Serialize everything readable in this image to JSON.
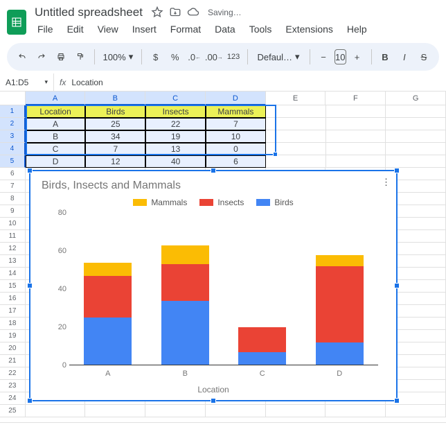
{
  "doc": {
    "title": "Untitled spreadsheet",
    "status": "Saving…"
  },
  "menus": [
    "File",
    "Edit",
    "View",
    "Insert",
    "Format",
    "Data",
    "Tools",
    "Extensions",
    "Help"
  ],
  "toolbar": {
    "zoom": "100%",
    "currency": "$",
    "percent": "%",
    "font": "Defaul…",
    "fontsize": "10",
    "fmt123": "123"
  },
  "namebox": {
    "ref": "A1:D5",
    "formula": "Location"
  },
  "columns": [
    "A",
    "B",
    "C",
    "D",
    "E",
    "F",
    "G"
  ],
  "rows_visible": 25,
  "table": {
    "headers": [
      "Location",
      "Birds",
      "Insects",
      "Mammals"
    ],
    "rows": [
      [
        "A",
        "25",
        "22",
        "7"
      ],
      [
        "B",
        "34",
        "19",
        "10"
      ],
      [
        "C",
        "7",
        "13",
        "0"
      ],
      [
        "D",
        "12",
        "40",
        "6"
      ]
    ]
  },
  "chart_data": {
    "type": "bar",
    "stacked": true,
    "title": "Birds, Insects and Mammals",
    "xlabel": "Location",
    "ylabel": "",
    "ylim": [
      0,
      80
    ],
    "yticks": [
      0,
      20,
      40,
      60,
      80
    ],
    "categories": [
      "A",
      "B",
      "C",
      "D"
    ],
    "series": [
      {
        "name": "Birds",
        "color": "#4285f4",
        "values": [
          25,
          34,
          7,
          12
        ]
      },
      {
        "name": "Insects",
        "color": "#ea4335",
        "values": [
          22,
          19,
          13,
          40
        ]
      },
      {
        "name": "Mammals",
        "color": "#fbbc04",
        "values": [
          7,
          10,
          0,
          6
        ]
      }
    ],
    "legend_order": [
      "Mammals",
      "Insects",
      "Birds"
    ]
  },
  "colors": {
    "birds": "#4285f4",
    "insects": "#ea4335",
    "mammals": "#fbbc04"
  }
}
